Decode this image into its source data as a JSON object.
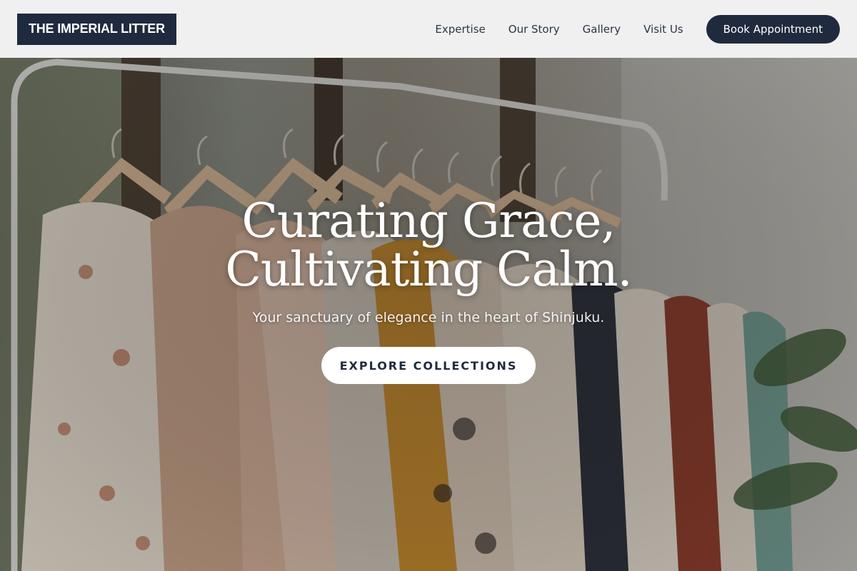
{
  "brand": {
    "name": "THE IMPERIAL LITTER"
  },
  "nav": {
    "items": [
      {
        "label": "Expertise"
      },
      {
        "label": "Our Story"
      },
      {
        "label": "Gallery"
      },
      {
        "label": "Visit Us"
      }
    ],
    "cta_label": "Book Appointment"
  },
  "hero": {
    "title_line1": "Curating Grace,",
    "title_line2": "Cultivating Calm.",
    "subtitle": "Your sanctuary of elegance in the heart of Shinjuku.",
    "cta_label": "EXPLORE COLLECTIONS",
    "background_image": "clothing-rack-photo"
  },
  "colors": {
    "brand_navy": "#1f2a3e",
    "header_bg": "#f7f7f7",
    "hero_text": "#ffffff"
  }
}
